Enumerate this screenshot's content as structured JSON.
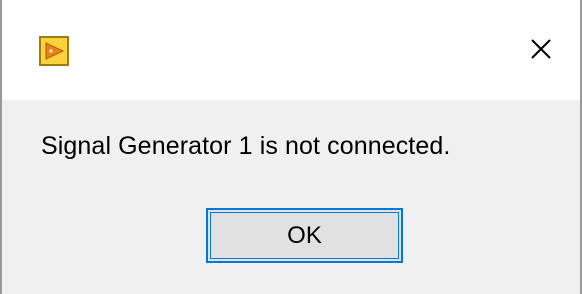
{
  "window": {
    "app_icon": "labview-run-arrow-icon",
    "close_icon": "close-icon"
  },
  "dialog": {
    "message": "Signal Generator 1 is not connected.",
    "ok_label": "OK"
  },
  "colors": {
    "titlebar": "#ffffff",
    "body": "#f0f0f0",
    "button_face": "#e1e1e1",
    "button_focus_border": "#0078d7",
    "icon_fill": "#f9d23c",
    "icon_border": "#a07c10",
    "icon_arrow": "#e8811c"
  }
}
